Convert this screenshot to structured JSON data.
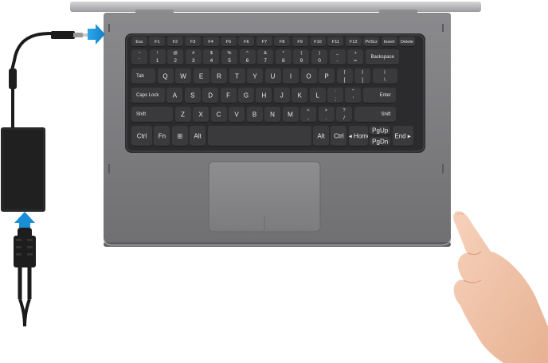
{
  "scene": {
    "colors": {
      "chassis": "#7b7b7e",
      "keyboard_well": "#2b2b2d",
      "key": "#3a3a3c",
      "key_text": "#e8e8e8",
      "arrow": "#1a8fd8",
      "adapter": "#1f1f1f",
      "skin": "#f1c7ab"
    },
    "icons": [
      "power-plug-arrow-icon",
      "power-cord-arrow-icon",
      "power-button-press-icon"
    ]
  },
  "keyboard": {
    "fn_row": [
      {
        "label": "Esc"
      },
      {
        "label": "F1"
      },
      {
        "label": "F2"
      },
      {
        "label": "F3"
      },
      {
        "label": "F4"
      },
      {
        "label": "F5"
      },
      {
        "label": "F6"
      },
      {
        "label": "F7"
      },
      {
        "label": "F8"
      },
      {
        "label": "F9"
      },
      {
        "label": "F10"
      },
      {
        "label": "F11"
      },
      {
        "label": "F12"
      },
      {
        "label": "PrtScr"
      },
      {
        "label": "Insert"
      },
      {
        "label": "Delete"
      }
    ],
    "number_row": [
      {
        "top": "~",
        "bottom": "`"
      },
      {
        "top": "!",
        "bottom": "1"
      },
      {
        "top": "@",
        "bottom": "2"
      },
      {
        "top": "#",
        "bottom": "3"
      },
      {
        "top": "$",
        "bottom": "4"
      },
      {
        "top": "%",
        "bottom": "5"
      },
      {
        "top": "^",
        "bottom": "6"
      },
      {
        "top": "&",
        "bottom": "7"
      },
      {
        "top": "*",
        "bottom": "8"
      },
      {
        "top": "(",
        "bottom": "9"
      },
      {
        "top": ")",
        "bottom": "0"
      },
      {
        "top": "_",
        "bottom": "-"
      },
      {
        "top": "+",
        "bottom": "="
      },
      {
        "label": "Backspace"
      }
    ],
    "top_row": [
      {
        "label": "Tab"
      },
      {
        "label": "Q"
      },
      {
        "label": "W"
      },
      {
        "label": "E"
      },
      {
        "label": "R"
      },
      {
        "label": "T"
      },
      {
        "label": "Y"
      },
      {
        "label": "U"
      },
      {
        "label": "I"
      },
      {
        "label": "O"
      },
      {
        "label": "P"
      },
      {
        "top": "{",
        "bottom": "["
      },
      {
        "top": "}",
        "bottom": "]"
      },
      {
        "top": "|",
        "bottom": "\\"
      }
    ],
    "home_row": [
      {
        "label": "Caps Lock"
      },
      {
        "label": "A"
      },
      {
        "label": "S"
      },
      {
        "label": "D"
      },
      {
        "label": "F"
      },
      {
        "label": "G"
      },
      {
        "label": "H"
      },
      {
        "label": "J"
      },
      {
        "label": "K"
      },
      {
        "label": "L"
      },
      {
        "top": ":",
        "bottom": ";"
      },
      {
        "top": "\"",
        "bottom": "'"
      },
      {
        "label": "Enter"
      }
    ],
    "bottom_row": [
      {
        "label": "Shift"
      },
      {
        "label": "Z"
      },
      {
        "label": "X"
      },
      {
        "label": "C"
      },
      {
        "label": "V"
      },
      {
        "label": "B"
      },
      {
        "label": "N"
      },
      {
        "label": "M"
      },
      {
        "top": "<",
        "bottom": ","
      },
      {
        "top": ">",
        "bottom": "."
      },
      {
        "top": "?",
        "bottom": "/"
      },
      {
        "label": "Shift"
      }
    ],
    "space_row": [
      {
        "label": "Ctrl"
      },
      {
        "label": "Fn"
      },
      {
        "label": "⊞"
      },
      {
        "label": "Alt"
      },
      {
        "label": ""
      },
      {
        "label": "Alt"
      },
      {
        "label": "Ctrl"
      },
      {
        "label": "◂ Home"
      },
      {
        "label": "PgUp"
      },
      {
        "label": "PgDn"
      },
      {
        "label": "End ▸"
      }
    ]
  }
}
